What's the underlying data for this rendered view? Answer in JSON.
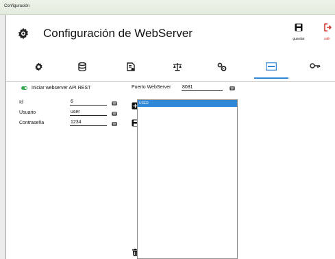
{
  "window": {
    "title": "Configuración"
  },
  "header": {
    "title": "Configuración de WebServer",
    "save_label": "guardar",
    "exit_label": "salir"
  },
  "tabs": [
    {
      "icon": "gear-icon"
    },
    {
      "icon": "database-icon"
    },
    {
      "icon": "document-settings-icon"
    },
    {
      "icon": "scale-icon"
    },
    {
      "icon": "gears-icon"
    },
    {
      "icon": "api-icon",
      "active": true
    },
    {
      "icon": "key-icon"
    }
  ],
  "form": {
    "enable_label": "Iniciar webserver API REST",
    "enabled": true,
    "port_label": "Puerto WebServer",
    "port_value": "8081",
    "id_label": "Id",
    "id_value": "6",
    "user_label": "Usuario",
    "user_value": "user",
    "password_label": "Contraseña",
    "password_value": "1234"
  },
  "list": {
    "items": [
      "USER"
    ]
  },
  "colors": {
    "accent": "#2f87d6",
    "toggle": "#2fa84f",
    "exit": "#d43a2f"
  }
}
